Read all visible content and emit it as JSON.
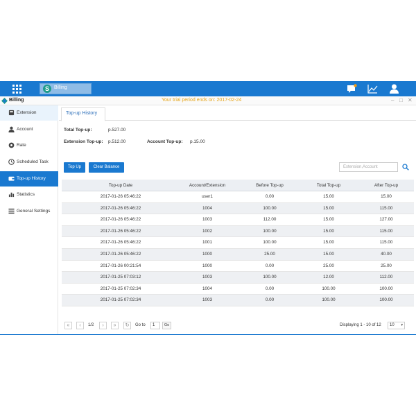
{
  "taskbar": {
    "app_tab_label": "Billing",
    "app_tab_icon_letter": "S",
    "icons": [
      "apps-grid-icon",
      "notification-icon",
      "chart-icon",
      "user-icon"
    ],
    "color": "#1a79d0"
  },
  "window": {
    "title": "Billing",
    "trial_notice": "Your trial period ends on: 2017-02-24",
    "trial_color": "#e5a418",
    "controls": [
      "–",
      "□",
      "✕"
    ]
  },
  "sidebar": {
    "items": [
      {
        "label": "Extension",
        "icon": "extension-icon"
      },
      {
        "label": "Account",
        "icon": "account-icon"
      },
      {
        "label": "Rate",
        "icon": "rate-icon"
      },
      {
        "label": "Scheduled Task",
        "icon": "clock-icon"
      },
      {
        "label": "Top-up History",
        "icon": "wallet-icon",
        "active": true
      },
      {
        "label": "Statistics",
        "icon": "statistics-icon"
      },
      {
        "label": "General Settings",
        "icon": "settings-icon"
      }
    ]
  },
  "main": {
    "tab": "Top-up History",
    "summary": {
      "total_label": "Total Top-up:",
      "total_value": "p.527.00",
      "extension_label": "Extension Top-up:",
      "extension_value": "p.512.00",
      "account_label": "Account Top-up:",
      "account_value": "p.15.00"
    },
    "buttons": {
      "top_up": "Top Up",
      "clear_balance": "Clear Balance"
    },
    "search": {
      "placeholder": "Extension,Account"
    },
    "table": {
      "columns": [
        "Top-up Date",
        "Account/Extension",
        "Before Top-up",
        "Total Top-up",
        "After Top-up"
      ],
      "rows": [
        [
          "2017-01-26 05:46:22",
          "user1",
          "0.00",
          "15.00",
          "15.00"
        ],
        [
          "2017-01-26 05:46:22",
          "1004",
          "100.00",
          "15.00",
          "115.00"
        ],
        [
          "2017-01-26 05:46:22",
          "1003",
          "112.00",
          "15.00",
          "127.00"
        ],
        [
          "2017-01-26 05:46:22",
          "1002",
          "100.00",
          "15.00",
          "115.00"
        ],
        [
          "2017-01-26 05:46:22",
          "1001",
          "100.00",
          "15.00",
          "115.00"
        ],
        [
          "2017-01-26 05:46:22",
          "1000",
          "25.00",
          "15.00",
          "40.00"
        ],
        [
          "2017-01-26 00:21:54",
          "1000",
          "0.00",
          "25.00",
          "25.00"
        ],
        [
          "2017-01-25 07:03:12",
          "1003",
          "100.00",
          "12.00",
          "112.00"
        ],
        [
          "2017-01-25 07:02:34",
          "1004",
          "0.00",
          "100.00",
          "100.00"
        ],
        [
          "2017-01-25 07:02:34",
          "1003",
          "0.00",
          "100.00",
          "100.00"
        ]
      ]
    },
    "pager": {
      "page": "1/2",
      "goto_label": "Go to",
      "goto_value": "1",
      "go_label": "Go",
      "displaying": "Displaying 1 - 10 of 12",
      "page_size": "10"
    }
  }
}
